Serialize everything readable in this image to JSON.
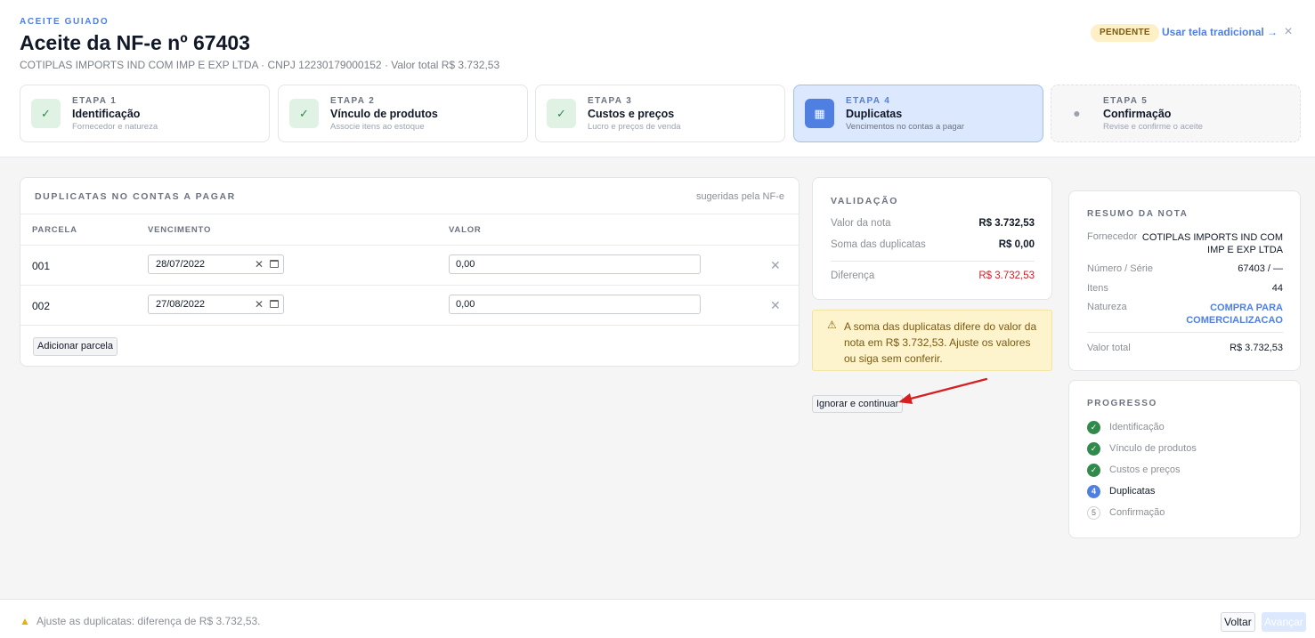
{
  "header": {
    "eyebrow": "ACEITE GUIADO",
    "title": "Aceite da NF-e nº 67403",
    "subtitle": "COTIPLAS IMPORTS IND COM IMP E EXP LTDA · CNPJ 12230179000152 · Valor total R$ 3.732,53",
    "status_badge": "PENDENTE",
    "traditional_link": "Usar tela tradicional →",
    "close_glyph": "×"
  },
  "steps": [
    {
      "label": "ETAPA 1",
      "name": "Identificação",
      "desc": "Fornecedor e natureza",
      "icon": "✓",
      "state": "done"
    },
    {
      "label": "ETAPA 2",
      "name": "Vínculo de produtos",
      "desc": "Associe itens ao estoque",
      "icon": "✓",
      "state": "done"
    },
    {
      "label": "ETAPA 3",
      "name": "Custos e preços",
      "desc": "Lucro e preços de venda",
      "icon": "✓",
      "state": "done"
    },
    {
      "label": "ETAPA 4",
      "name": "Duplicatas",
      "desc": "Vencimentos no contas a pagar",
      "icon": "▦",
      "state": "active"
    },
    {
      "label": "ETAPA 5",
      "name": "Confirmação",
      "desc": "Revise e confirme o aceite",
      "icon": "●",
      "state": "todo"
    }
  ],
  "duplicatas": {
    "title": "DUPLICATAS NO CONTAS A PAGAR",
    "hint": "sugeridas pela NF-e",
    "columns": [
      "PARCELA",
      "VENCIMENTO",
      "VALOR"
    ],
    "rows": [
      {
        "parcela": "001",
        "vencimento": "28/07/2022",
        "valor": "0,00"
      },
      {
        "parcela": "002",
        "vencimento": "27/08/2022",
        "valor": "0,00"
      }
    ],
    "add_label": "Adicionar parcela"
  },
  "validacao": {
    "title": "VALIDAÇÃO",
    "valor_nota_label": "Valor da nota",
    "valor_nota": "R$ 3.732,53",
    "soma_label": "Soma das duplicatas",
    "soma": "R$ 0,00",
    "diferenca_label": "Diferença",
    "diferenca": "R$ 3.732,53"
  },
  "warning": {
    "icon": "⚠",
    "text": "A soma das duplicatas difere do valor da nota em R$ 3.732,53. Ajuste os valores ou siga sem conferir."
  },
  "ignore_button": "Ignorar e continuar",
  "resumo": {
    "title": "RESUMO DA NOTA",
    "fornecedor_label": "Fornecedor",
    "fornecedor": "COTIPLAS IMPORTS IND COM IMP E EXP LTDA",
    "numero_label": "Número / Série",
    "numero": "67403 / —",
    "itens_label": "Itens",
    "itens": "44",
    "natureza_label": "Natureza",
    "natureza": "COMPRA PARA COMERCIALIZACAO",
    "total_label": "Valor total",
    "total": "R$ 3.732,53"
  },
  "progresso": {
    "title": "PROGRESSO",
    "items": [
      {
        "label": "Identificação",
        "mark": "✓",
        "state": "done"
      },
      {
        "label": "Vínculo de produtos",
        "mark": "✓",
        "state": "done"
      },
      {
        "label": "Custos e preços",
        "mark": "✓",
        "state": "done"
      },
      {
        "label": "Duplicatas",
        "mark": "4",
        "state": "cur"
      },
      {
        "label": "Confirmação",
        "mark": "5",
        "state": "todo"
      }
    ]
  },
  "footer": {
    "icon": "▲",
    "text": "Ajuste as duplicatas: diferença de R$ 3.732,53.",
    "back_label": "Voltar",
    "next_label": "Avançar"
  },
  "colors": {
    "accent": "#4f7fe0",
    "success": "#2f8a4c",
    "danger": "#d11f2a",
    "warning_bg": "#fdf3cc",
    "annotation_arrow": "#d62020"
  }
}
